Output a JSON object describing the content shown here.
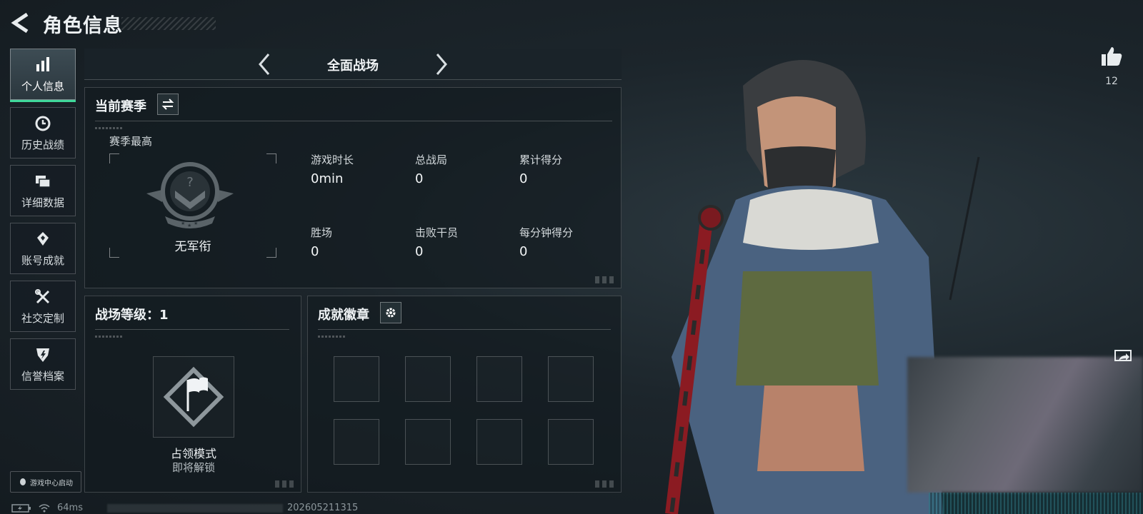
{
  "header": {
    "title": "角色信息"
  },
  "sidebar": {
    "items": [
      {
        "label": "个人信息",
        "icon": "bar-chart-icon",
        "active": true
      },
      {
        "label": "历史战绩",
        "icon": "history-icon",
        "active": false
      },
      {
        "label": "详细数据",
        "icon": "folder-icon",
        "active": false
      },
      {
        "label": "账号成就",
        "icon": "achievement-icon",
        "active": false
      },
      {
        "label": "社交定制",
        "icon": "tools-icon",
        "active": false
      },
      {
        "label": "信誉档案",
        "icon": "shield-icon",
        "active": false
      }
    ],
    "launch_badge": "游戏中心启动"
  },
  "mode_selector": {
    "title": "全面战场"
  },
  "current_season": {
    "title": "当前赛季",
    "season_best_label": "赛季最高",
    "rank_name": "无军衔",
    "stats": [
      {
        "label": "游戏时长",
        "value": "0min"
      },
      {
        "label": "总战局",
        "value": "0"
      },
      {
        "label": "累计得分",
        "value": "0"
      },
      {
        "label": "胜场",
        "value": "0"
      },
      {
        "label": "击败干员",
        "value": "0"
      },
      {
        "label": "每分钟得分",
        "value": "0"
      }
    ]
  },
  "battlefield_level": {
    "title": "战场等级：1",
    "mode_name": "占领模式",
    "mode_status": "即将解锁"
  },
  "achievements": {
    "title": "成就徽章",
    "slot_count": 8
  },
  "status_bar": {
    "ping": "64ms",
    "build_id": "202605211315"
  },
  "likes": {
    "count": "12"
  },
  "colors": {
    "accent": "#3fd89a",
    "background": "#1c252b"
  }
}
